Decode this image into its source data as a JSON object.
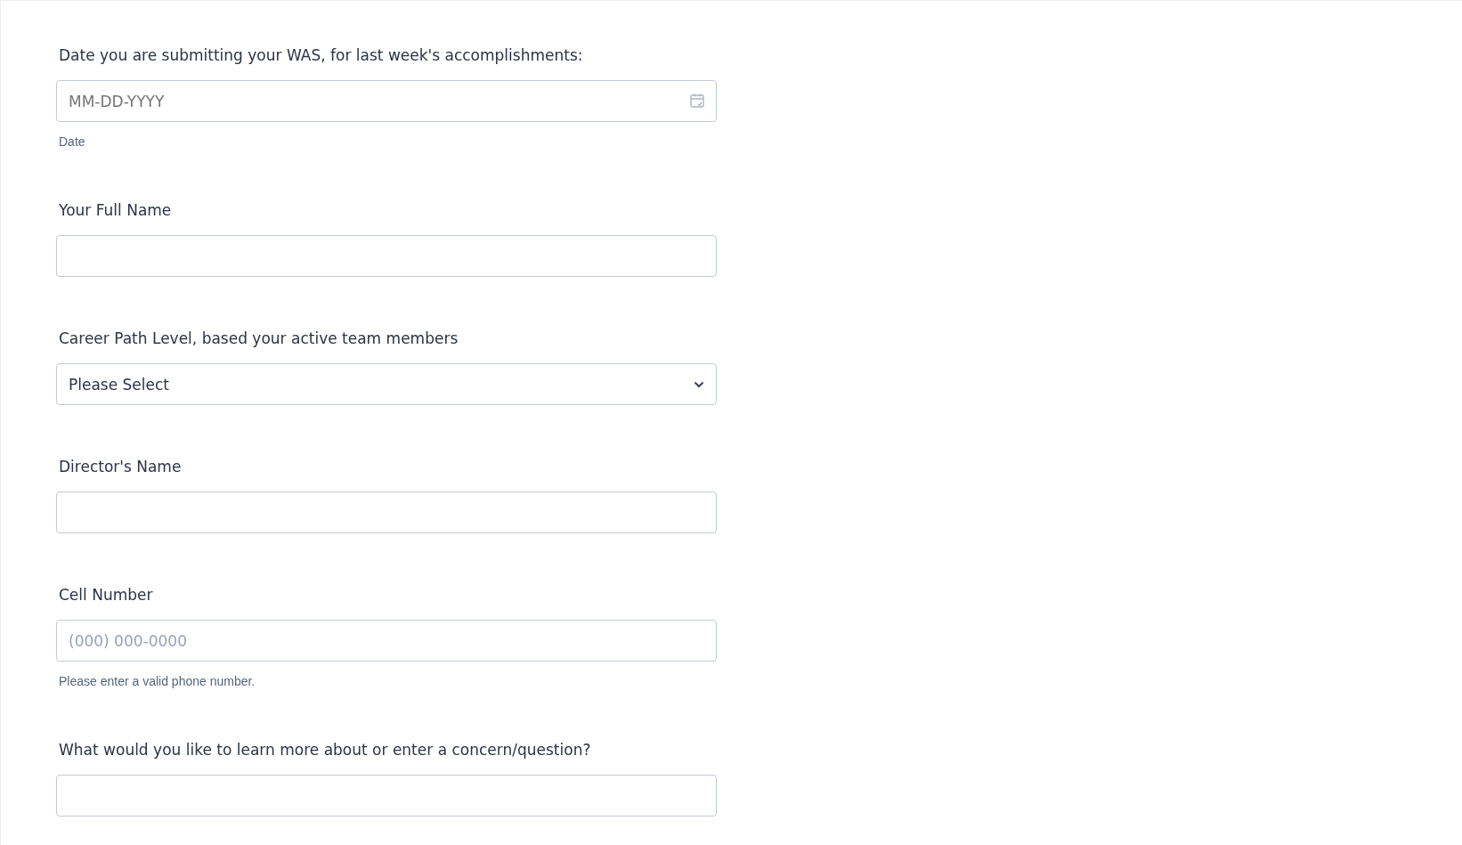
{
  "fields": [
    {
      "kind": "date",
      "label": "Date you are submitting your WAS, for last week's accomplishments:",
      "placeholder": "MM-DD-YYYY",
      "helper": "Date"
    },
    {
      "kind": "text",
      "label": "Your Full Name"
    },
    {
      "kind": "select",
      "label": "Career Path Level, based your active team members",
      "value": "Please Select"
    },
    {
      "kind": "text",
      "label": "Director's Name"
    },
    {
      "kind": "text",
      "label": "Cell Number",
      "placeholder": "(000) 000-0000",
      "helper": "Please enter a valid phone number."
    },
    {
      "kind": "text",
      "label": "What would you like to learn more about or enter a concern/question?"
    }
  ]
}
